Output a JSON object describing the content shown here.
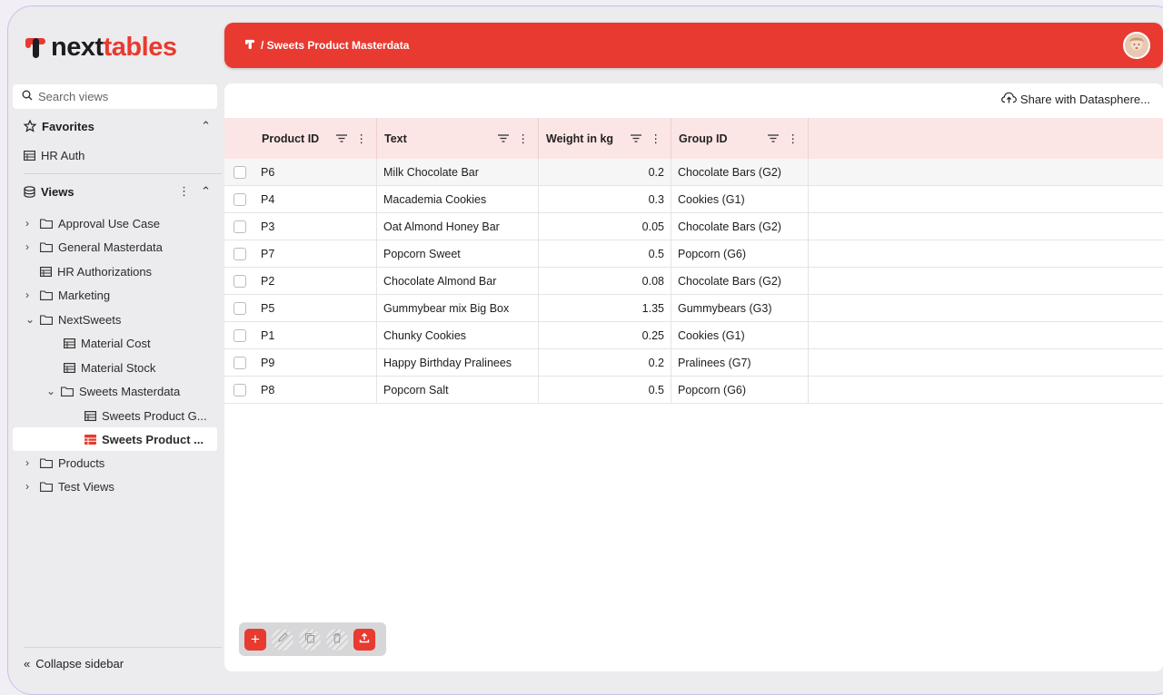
{
  "app": {
    "logo_part1": "next",
    "logo_part2": "tables"
  },
  "search": {
    "placeholder": "Search views"
  },
  "favorites": {
    "title": "Favorites",
    "items": [
      {
        "label": "HR Auth"
      }
    ]
  },
  "views": {
    "title": "Views",
    "items": [
      {
        "label": "Approval Use Case"
      },
      {
        "label": "General Masterdata"
      },
      {
        "label": "HR Authorizations"
      },
      {
        "label": "Marketing"
      },
      {
        "label": "NextSweets"
      },
      {
        "label": "Material Cost"
      },
      {
        "label": "Material Stock"
      },
      {
        "label": "Sweets Masterdata"
      },
      {
        "label": "Sweets Product G..."
      },
      {
        "label": "Sweets Product ..."
      },
      {
        "label": "Products"
      },
      {
        "label": "Test Views"
      }
    ]
  },
  "sidebar": {
    "collapse_label": "Collapse sidebar"
  },
  "header": {
    "breadcrumb": "/ Sweets Product Masterdata"
  },
  "main": {
    "share_label": "Share with Datasphere..."
  },
  "table": {
    "columns": [
      "Product ID",
      "Text",
      "Weight in kg",
      "Group ID"
    ],
    "rows": [
      [
        "P6",
        "Milk Chocolate Bar",
        "0.2",
        "Chocolate Bars (G2)"
      ],
      [
        "P4",
        "Macademia Cookies",
        "0.3",
        "Cookies (G1)"
      ],
      [
        "P3",
        "Oat Almond Honey Bar",
        "0.05",
        "Chocolate Bars (G2)"
      ],
      [
        "P7",
        "Popcorn Sweet",
        "0.5",
        "Popcorn (G6)"
      ],
      [
        "P2",
        "Chocolate Almond Bar",
        "0.08",
        "Chocolate Bars (G2)"
      ],
      [
        "P5",
        "Gummybear mix Big Box",
        "1.35",
        "Gummybears (G3)"
      ],
      [
        "P1",
        "Chunky Cookies",
        "0.25",
        "Cookies (G1)"
      ],
      [
        "P9",
        "Happy Birthday Pralinees",
        "0.2",
        "Pralinees (G7)"
      ],
      [
        "P8",
        "Popcorn Salt",
        "0.5",
        "Popcorn (G6)"
      ]
    ]
  },
  "colors": {
    "accent": "#e83a30",
    "header_row": "#fce6e5"
  },
  "icons": [
    "search-icon",
    "star-icon",
    "table-icon",
    "database-icon",
    "folder-icon",
    "chevron-icon",
    "cloud-upload-icon",
    "filter-icon",
    "more-vertical-icon",
    "plus-icon",
    "edit-icon",
    "copy-icon",
    "delete-icon",
    "upload-icon"
  ]
}
